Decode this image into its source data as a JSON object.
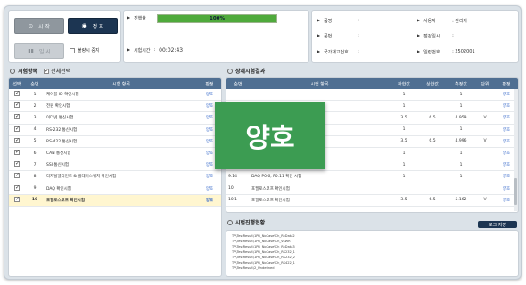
{
  "controls": {
    "start_label": "시 작",
    "stop_label": "정 지",
    "pause_label": "일 시",
    "repeat_label": "불량시 중지"
  },
  "progress": {
    "label": "진행율",
    "percent": 100,
    "percent_text": "100%",
    "time_label": "시험시간",
    "time_value": "00:02:43"
  },
  "info": {
    "fields": [
      {
        "label": "품명",
        "value": ":"
      },
      {
        "label": "품번",
        "value": ":"
      },
      {
        "label": "국가재고번호",
        "value": ":"
      },
      {
        "label": "사용자",
        "value": ": 관리자"
      },
      {
        "label": "점검일시",
        "value": ":"
      },
      {
        "label": "일련번호",
        "value": ": 2502001"
      }
    ]
  },
  "left": {
    "section_title": "시험항목",
    "select_all_label": "전체선택",
    "columns": [
      "선택",
      "순번",
      "시험 항목",
      "판정"
    ],
    "rows": [
      {
        "no": "1",
        "item": "케이블 ID 확인시험",
        "result": "양호"
      },
      {
        "no": "2",
        "item": "전원 확인시험",
        "result": "양호"
      },
      {
        "no": "3",
        "item": "이더넷 통신시험",
        "result": "양호"
      },
      {
        "no": "4",
        "item": "RS-232 통신시험",
        "result": "양호"
      },
      {
        "no": "5",
        "item": "RS-422 통신시험",
        "result": "양호"
      },
      {
        "no": "6",
        "item": "CAN 통신시험",
        "result": "양호"
      },
      {
        "no": "7",
        "item": "SSI 통신시험",
        "result": "양호"
      },
      {
        "no": "8",
        "item": "디지털엘리먼트 & 릴레이스위치 확인시험",
        "result": "양호"
      },
      {
        "no": "9",
        "item": "DAQ 확인시험",
        "result": "양호"
      },
      {
        "no": "10",
        "item": "포필로스코프 확인시험",
        "result": "양호"
      }
    ]
  },
  "right": {
    "section_title": "상세시험결과",
    "columns": [
      "순번",
      "시험 항목",
      "하한값",
      "상한값",
      "측정값",
      "단위",
      "판정"
    ],
    "rows": [
      {
        "no": "",
        "item": "",
        "low": "1",
        "high": "",
        "meas": "1",
        "unit": "",
        "result": "양호"
      },
      {
        "no": "",
        "item": "",
        "low": "1",
        "high": "",
        "meas": "1",
        "unit": "",
        "result": "양호"
      },
      {
        "no": "",
        "item": "",
        "low": "3.5",
        "high": "6.5",
        "meas": "4.959",
        "unit": "V",
        "result": "양호"
      },
      {
        "no": "",
        "item": "",
        "low": "1",
        "high": "",
        "meas": "1",
        "unit": "",
        "result": "양호"
      },
      {
        "no": "",
        "item": "",
        "low": "3.5",
        "high": "6.5",
        "meas": "4.996",
        "unit": "V",
        "result": "양호"
      },
      {
        "no": "",
        "item": "",
        "low": "1",
        "high": "",
        "meas": "1",
        "unit": "",
        "result": "양호"
      },
      {
        "no": "9.13",
        "item": "DAQ AO2, P0.17 확인 시험",
        "low": "1",
        "high": "",
        "meas": "1",
        "unit": "",
        "result": "양호"
      },
      {
        "no": "9.14",
        "item": "DAQ P0.6, P0.11 확인 시험",
        "low": "1",
        "high": "",
        "meas": "1",
        "unit": "",
        "result": "양호"
      },
      {
        "no": "10",
        "item": "포필로스코프 확인시험",
        "low": "",
        "high": "",
        "meas": "",
        "unit": "",
        "result": "양호"
      },
      {
        "no": "10.1",
        "item": "포필로스코프 확인시험",
        "low": "3.5",
        "high": "6.5",
        "meas": "5.162",
        "unit": "V",
        "result": "양호"
      }
    ]
  },
  "overlay": {
    "text": "양호"
  },
  "log": {
    "section_title": "시험진행현황",
    "button_label": "로그 저장",
    "lines": [
      "TP\\TestResult\\1PR_NoCase\\Ch_RxData2",
      "TP\\TestResult\\1PR_NoCase\\Ch_vSWR",
      "TP\\TestResult\\1PR_NoCase\\Ch_RxData3",
      "TP\\TestResult\\1PR_NoCase\\Ch_RS232_1",
      "TP\\TestResult\\1PR_NoCase\\Ch_RS232_2",
      "TP\\TestResult\\1PR_NoCase\\Ch_RS422_1",
      "TP\\TestResult\\2_Undefined"
    ]
  },
  "colors": {
    "accent": "#4f6f92",
    "pass": "#2d62c7",
    "overlay": "#3c9c52",
    "progress": "#4faa3c"
  }
}
